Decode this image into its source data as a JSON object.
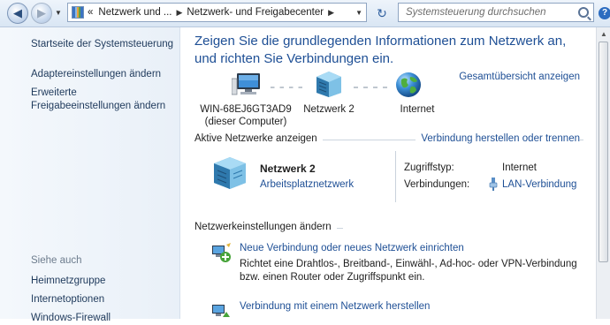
{
  "address_bar": {
    "back_glyph": "◀",
    "forward_glyph": "▶",
    "breadcrumb_prefix": "«",
    "crumb1": "Netzwerk und ...",
    "crumb2": "Netzwerk- und Freigabecenter",
    "refresh_glyph": "↻"
  },
  "search": {
    "placeholder": "Systemsteuerung durchsuchen"
  },
  "help_glyph": "?",
  "sidebar": {
    "items": [
      {
        "label": "Startseite der Systemsteuerung"
      },
      {
        "label": "Adaptereinstellungen ändern"
      },
      {
        "label": "Erweiterte Freigabeeinstellungen ändern"
      }
    ],
    "see_also_title": "Siehe auch",
    "see_also": [
      {
        "label": "Heimnetzgruppe"
      },
      {
        "label": "Internetoptionen"
      },
      {
        "label": "Windows-Firewall"
      }
    ]
  },
  "main": {
    "heading": "Zeigen Sie die grundlegenden Informationen zum Netzwerk an, und richten Sie Verbindungen ein.",
    "overview_link": "Gesamtübersicht anzeigen",
    "map": {
      "computer_name": "WIN-68EJ6GT3AD9",
      "computer_sub": "(dieser Computer)",
      "network": "Netzwerk  2",
      "internet": "Internet"
    },
    "active": {
      "title": "Aktive Netzwerke anzeigen",
      "link": "Verbindung herstellen oder trennen",
      "network_name": "Netzwerk  2",
      "network_type": "Arbeitsplatznetzwerk",
      "access_label": "Zugriffstyp:",
      "access_value": "Internet",
      "connections_label": "Verbindungen:",
      "connections_value": "LAN-Verbindung"
    },
    "settings": {
      "title": "Netzwerkeinstellungen ändern",
      "tasks": [
        {
          "link": "Neue Verbindung oder neues Netzwerk einrichten",
          "desc": "Richtet eine Drahtlos-, Breitband-, Einwähl-, Ad-hoc- oder VPN-Verbindung bzw. einen Router oder Zugriffspunkt ein."
        },
        {
          "link": "Verbindung mit einem Netzwerk herstellen"
        }
      ]
    }
  },
  "colors": {
    "link": "#1e4f95",
    "heading": "#1e4f95",
    "sidebar_bg": "#eaf1f8"
  },
  "icons": [
    "back-arrow-icon",
    "forward-arrow-icon",
    "control-panel-icon",
    "refresh-icon",
    "search-icon",
    "help-icon",
    "computer-icon",
    "network-icon",
    "globe-icon",
    "lan-plug-icon",
    "new-connection-icon",
    "connect-network-icon"
  ]
}
